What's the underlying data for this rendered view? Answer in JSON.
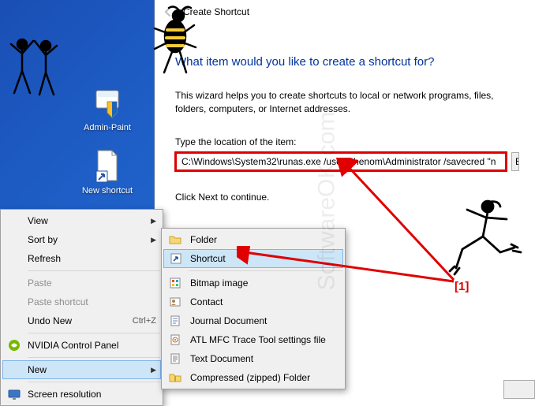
{
  "desktop": {
    "icons": {
      "admin_paint": "Admin-Paint",
      "new_shortcut": "New shortcut"
    }
  },
  "context_menu": {
    "view": "View",
    "sort_by": "Sort by",
    "refresh": "Refresh",
    "paste": "Paste",
    "paste_shortcut": "Paste shortcut",
    "undo_new": "Undo New",
    "undo_kbd": "Ctrl+Z",
    "nvidia": "NVIDIA Control Panel",
    "new": "New",
    "screen_resolution": "Screen resolution"
  },
  "new_submenu": {
    "folder": "Folder",
    "shortcut": "Shortcut",
    "bitmap": "Bitmap image",
    "contact": "Contact",
    "journal": "Journal Document",
    "atl": "ATL MFC Trace Tool settings file",
    "textdoc": "Text Document",
    "compressed": "Compressed (zipped) Folder"
  },
  "wizard": {
    "title": "Create Shortcut",
    "heading": "What item would you like to create a shortcut for?",
    "description": "This wizard helps you to create shortcuts to local or network programs, files, folders, computers, or Internet addresses.",
    "location_label": "Type the location of the item:",
    "location_value": "C:\\Windows\\System32\\runas.exe /user:Phenom\\Administrator /savecred \"n",
    "browse": "B",
    "click_next": "Click Next to continue."
  },
  "annotation": {
    "one": "[1]"
  },
  "watermark": "SoftwareOK.com"
}
